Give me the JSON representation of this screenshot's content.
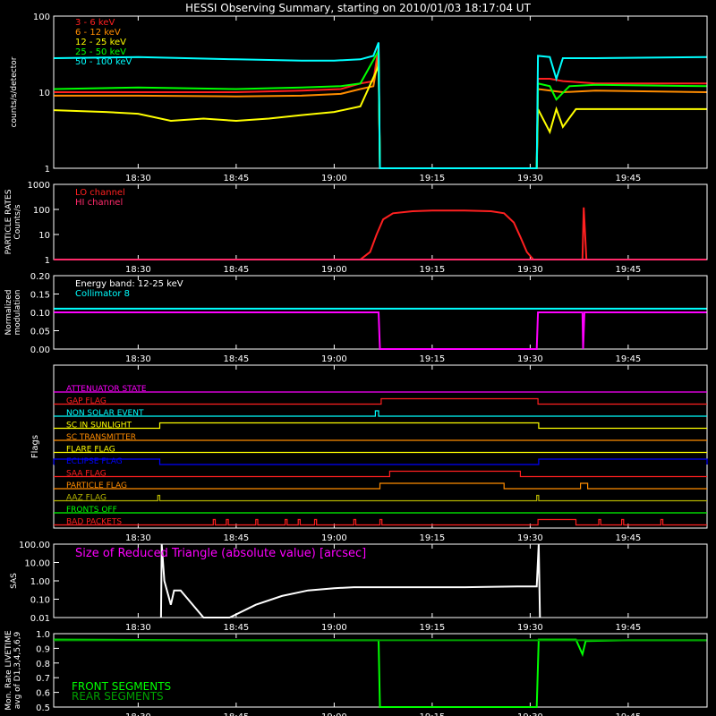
{
  "figure": {
    "title": "HESSI Observing Summary, starting on 2010/01/03 18:17:04 UT",
    "time_ticks": [
      "18:30",
      "18:45",
      "19:00",
      "19:15",
      "19:30",
      "19:45"
    ],
    "time_tick_minutes": [
      30,
      45,
      60,
      75,
      90,
      105
    ],
    "time_range_minutes": [
      17.07,
      117.07
    ]
  },
  "colors": {
    "red": "#ff2020",
    "orange": "#ff8c00",
    "yellow": "#ffff00",
    "green": "#00ff00",
    "cyan": "#00ffff",
    "magenta": "#ff00ff",
    "hot_pink": "#ff2a6a",
    "white": "#ffffff",
    "blue": "#0000ff",
    "olive": "#b5b500",
    "front_green": "#00ff00",
    "rear_green": "#00a000"
  },
  "chart_data": [
    {
      "type": "line",
      "id": "count_rates",
      "ylabel": "counts/s/detector",
      "yscale": "log",
      "ylim": [
        1,
        100
      ],
      "y_ticks": [
        1,
        10,
        100
      ],
      "y_tick_labels": [
        "1",
        "10",
        "100"
      ],
      "series": [
        {
          "name": "3 - 6 keV",
          "color": "red",
          "values": [
            [
              17.1,
              10
            ],
            [
              30,
              10
            ],
            [
              45,
              10
            ],
            [
              55,
              10.5
            ],
            [
              61,
              11
            ],
            [
              64,
              13
            ],
            [
              66,
              14
            ],
            [
              66.8,
              40
            ],
            [
              67,
              1
            ],
            [
              91,
              1
            ],
            [
              91.2,
              15
            ],
            [
              93,
              15
            ],
            [
              95,
              14
            ],
            [
              100,
              13
            ],
            [
              117,
              13
            ]
          ]
        },
        {
          "name": "6 - 12 keV",
          "color": "orange",
          "values": [
            [
              17.1,
              9
            ],
            [
              30,
              9
            ],
            [
              45,
              8.8
            ],
            [
              55,
              9
            ],
            [
              61,
              9.5
            ],
            [
              64,
              11
            ],
            [
              66,
              12
            ],
            [
              66.8,
              30
            ],
            [
              67,
              1
            ],
            [
              91,
              1
            ],
            [
              91.2,
              11
            ],
            [
              95,
              10
            ],
            [
              100,
              10.5
            ],
            [
              117,
              10
            ]
          ]
        },
        {
          "name": "12 - 25 keV",
          "color": "yellow",
          "values": [
            [
              17.1,
              5.8
            ],
            [
              25,
              5.5
            ],
            [
              30,
              5.2
            ],
            [
              35,
              4.2
            ],
            [
              40,
              4.5
            ],
            [
              45,
              4.2
            ],
            [
              50,
              4.5
            ],
            [
              55,
              5
            ],
            [
              60,
              5.5
            ],
            [
              64,
              6.5
            ],
            [
              66.8,
              22
            ],
            [
              67,
              1
            ],
            [
              91,
              1
            ],
            [
              91.2,
              6
            ],
            [
              93,
              3
            ],
            [
              94,
              6
            ],
            [
              95,
              3.5
            ],
            [
              97,
              6
            ],
            [
              105,
              6
            ],
            [
              117,
              6
            ]
          ]
        },
        {
          "name": "25 - 50 keV",
          "color": "green",
          "values": [
            [
              17.1,
              11
            ],
            [
              30,
              11.5
            ],
            [
              45,
              11
            ],
            [
              55,
              11.5
            ],
            [
              61,
              12
            ],
            [
              64,
              13
            ],
            [
              66.8,
              35
            ],
            [
              67,
              1
            ],
            [
              91,
              1
            ],
            [
              91.2,
              13
            ],
            [
              93,
              12
            ],
            [
              94,
              8
            ],
            [
              96,
              12
            ],
            [
              100,
              12.5
            ],
            [
              117,
              12
            ]
          ]
        },
        {
          "name": "50 - 100 keV",
          "color": "cyan",
          "values": [
            [
              17.1,
              28
            ],
            [
              30,
              29
            ],
            [
              45,
              27
            ],
            [
              55,
              26
            ],
            [
              60,
              26
            ],
            [
              64,
              27
            ],
            [
              66,
              30
            ],
            [
              66.8,
              45
            ],
            [
              67,
              1
            ],
            [
              91,
              1
            ],
            [
              91.2,
              30
            ],
            [
              93,
              29
            ],
            [
              94,
              15
            ],
            [
              95,
              28
            ],
            [
              100,
              28
            ],
            [
              117,
              29
            ]
          ]
        }
      ]
    },
    {
      "type": "line",
      "id": "particle_rates",
      "ylabel": "PARTICLE RATES",
      "ylabel2": "Counts/s",
      "yscale": "log",
      "ylim": [
        1,
        1000
      ],
      "y_ticks": [
        1,
        10,
        100,
        1000
      ],
      "y_tick_labels": [
        "1",
        "10",
        "100",
        "1000"
      ],
      "series": [
        {
          "name": "LO channel",
          "color": "red",
          "values": [
            [
              17.1,
              1
            ],
            [
              64,
              1
            ],
            [
              65.5,
              2
            ],
            [
              66.5,
              10
            ],
            [
              67.5,
              40
            ],
            [
              69,
              70
            ],
            [
              72,
              85
            ],
            [
              75,
              90
            ],
            [
              80,
              90
            ],
            [
              84,
              85
            ],
            [
              86,
              70
            ],
            [
              87.5,
              30
            ],
            [
              88.5,
              8
            ],
            [
              89.5,
              2
            ],
            [
              90.5,
              1
            ],
            [
              98,
              1
            ],
            [
              98.2,
              120
            ],
            [
              98.6,
              1
            ],
            [
              117,
              1
            ]
          ]
        },
        {
          "name": "HI channel",
          "color": "hot_pink",
          "values": [
            [
              17.1,
              1
            ],
            [
              117,
              1
            ]
          ]
        }
      ]
    },
    {
      "type": "line",
      "id": "modulation",
      "ylabel": "Normalized",
      "ylabel2": "modulation",
      "ylim": [
        0,
        0.2
      ],
      "y_ticks": [
        0,
        0.05,
        0.1,
        0.15,
        0.2
      ],
      "y_tick_labels": [
        "0.00",
        "0.05",
        "0.10",
        "0.15",
        "0.20"
      ],
      "annotation": "Energy band: 12-25 keV",
      "series": [
        {
          "name": "Collimator 8",
          "color": "cyan",
          "values": [
            [
              17.1,
              0.11
            ],
            [
              66.8,
              0.11
            ],
            [
              91.2,
              0.11
            ],
            [
              117,
              0.11
            ]
          ]
        },
        {
          "name": "",
          "color": "magenta",
          "values": [
            [
              17.1,
              0.1
            ],
            [
              66.8,
              0.1
            ],
            [
              67,
              0
            ],
            [
              91,
              0
            ],
            [
              91.2,
              0.1
            ],
            [
              98,
              0.1
            ],
            [
              98.1,
              0.0
            ],
            [
              98.3,
              0.1
            ],
            [
              117,
              0.1
            ]
          ]
        }
      ]
    },
    {
      "type": "line",
      "id": "flags",
      "ylabel": "Flags",
      "flags": [
        {
          "label": "ATTENUATOR STATE",
          "color": "magenta",
          "on": []
        },
        {
          "label": "GAP FLAG",
          "color": "red",
          "on": [
            [
              67.2,
              91.2
            ]
          ]
        },
        {
          "label": "NON SOLAR EVENT",
          "color": "cyan",
          "on": [
            [
              66.3,
              66.8
            ]
          ]
        },
        {
          "label": "SC IN SUNLIGHT",
          "color": "yellow",
          "on": [
            [
              33.3,
              91.3
            ]
          ]
        },
        {
          "label": "SC TRANSMITTER",
          "color": "orange",
          "on": []
        },
        {
          "label": "FLARE FLAG",
          "color": "yellow",
          "on": []
        },
        {
          "label": "ECLIPSE FLAG",
          "color": "blue",
          "on": [
            [
              17.1,
              33.3
            ],
            [
              91.3,
              117.07
            ]
          ]
        },
        {
          "label": "SAA FLAG",
          "color": "red",
          "on": [
            [
              68.5,
              88.5
            ]
          ]
        },
        {
          "label": "PARTICLE FLAG",
          "color": "orange",
          "on": [
            [
              67,
              86
            ],
            [
              97.7,
              98.8
            ]
          ]
        },
        {
          "label": "AAZ FLAG",
          "color": "olive",
          "on": [
            [
              33,
              33.3
            ],
            [
              91,
              91.3
            ]
          ]
        },
        {
          "label": "FRONTS OFF",
          "color": "green",
          "on": []
        },
        {
          "label": "BAD PACKETS",
          "color": "red",
          "on": [
            [
              41.5,
              41.8
            ],
            [
              43.5,
              43.8
            ],
            [
              48,
              48.3
            ],
            [
              52.5,
              52.8
            ],
            [
              54.5,
              54.8
            ],
            [
              57,
              57.3
            ],
            [
              63,
              63.3
            ],
            [
              67,
              67.3
            ],
            [
              91.2,
              97
            ],
            [
              100.5,
              100.8
            ],
            [
              104,
              104.3
            ],
            [
              110,
              110.3
            ]
          ]
        }
      ]
    },
    {
      "type": "line",
      "id": "sas",
      "ylabel": "SAS",
      "yscale": "log",
      "ylim": [
        0.01,
        100
      ],
      "y_ticks": [
        0.01,
        0.1,
        1,
        10,
        100
      ],
      "y_tick_labels": [
        "0.01",
        "0.10",
        "1.00",
        "10.00",
        "100.00"
      ],
      "annotation": "Size of Reduced Triangle (absolute value) [arcsec]",
      "series": [
        {
          "name": "",
          "color": "white",
          "values": [
            [
              33.5,
              0.01
            ],
            [
              33.6,
              100
            ],
            [
              34,
              1
            ],
            [
              35,
              0.05
            ],
            [
              35.5,
              0.3
            ],
            [
              36.5,
              0.3
            ],
            [
              40,
              0.01
            ],
            [
              44,
              0.01
            ],
            [
              48,
              0.05
            ],
            [
              52,
              0.15
            ],
            [
              56,
              0.3
            ],
            [
              60,
              0.4
            ],
            [
              63,
              0.45
            ],
            [
              70,
              0.45
            ],
            [
              80,
              0.45
            ],
            [
              88,
              0.5
            ],
            [
              91,
              0.5
            ],
            [
              91.3,
              100
            ],
            [
              91.5,
              0.01
            ]
          ]
        }
      ]
    },
    {
      "type": "line",
      "id": "livetime",
      "ylabel": "Mon. Rate LIVETIME",
      "ylabel2": "avg of D1,3,4,5,6,9",
      "ylim": [
        0.5,
        1.0
      ],
      "y_ticks": [
        0.5,
        0.6,
        0.7,
        0.8,
        0.9,
        1.0
      ],
      "y_tick_labels": [
        "0.5",
        "0.6",
        "0.7",
        "0.8",
        "0.9",
        "1.0"
      ],
      "series": [
        {
          "name": "FRONT SEGMENTS",
          "color": "front_green",
          "values": [
            [
              17.1,
              0.96
            ],
            [
              40,
              0.955
            ],
            [
              60,
              0.955
            ],
            [
              66.8,
              0.955
            ],
            [
              67,
              0.5
            ],
            [
              91,
              0.5
            ],
            [
              91.3,
              0.96
            ],
            [
              97,
              0.96
            ],
            [
              98,
              0.86
            ],
            [
              98.5,
              0.95
            ],
            [
              105,
              0.955
            ],
            [
              117,
              0.955
            ]
          ]
        },
        {
          "name": "REAR SEGMENTS",
          "color": "rear_green",
          "values": [
            [
              17.1,
              0.955
            ],
            [
              66.8,
              0.955
            ],
            [
              91.3,
              0.955
            ],
            [
              117,
              0.955
            ]
          ]
        }
      ]
    }
  ]
}
